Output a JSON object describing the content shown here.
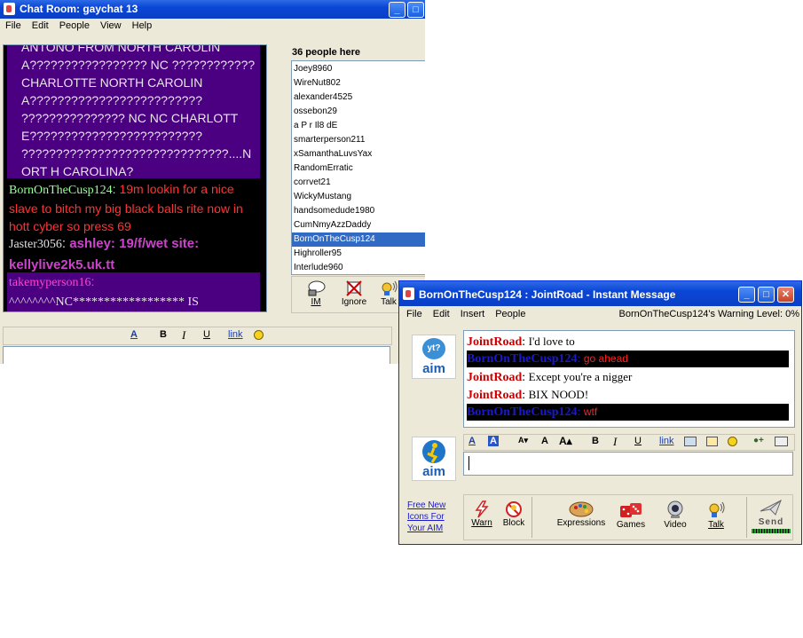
{
  "chat_window": {
    "title": "Chat Room: gaychat 13",
    "menu": [
      "File",
      "Edit",
      "People",
      "View",
      "Help"
    ],
    "messages_top_text": "ANTONO FROM NORTH CAROLINA????????????????? NC ???????????? CHARLOTTE NORTH CAROLINA????????????????????????? ??????????????? NC NC CHARLOTTE????????????????????????? ??????????????????????????????....NORT H CAROLINA?",
    "messages": [
      {
        "sender": "BornOnTheCusp124",
        "text": "19m lookin for a nice slave to bitch my big black balls rite now in hott cyber so press 69"
      },
      {
        "sender": "Jaster3056",
        "text": "ashley: 19/f/wet site: kellylive2k5.uk.tt"
      },
      {
        "sender": "takemyperson16",
        "text": "^^^^^^^^NC****************** IS"
      }
    ],
    "people_count": "36 people here",
    "people": [
      "Joey8960",
      "WireNut802",
      "alexander4525",
      "ossebon29",
      "a P r Il8 dE",
      "smarterperson211",
      "xSamanthaLuvsYax",
      "RandomErratic",
      "corrvet21",
      "WickyMustang",
      "handsomedude1980",
      "CumNmyAzzDaddy",
      "BornOnTheCusp124",
      "Highroller95",
      "Interlude960"
    ],
    "selected_person": "BornOnTheCusp124",
    "buttons": {
      "im": "IM",
      "ignore": "Ignore",
      "talk": "Talk"
    },
    "format": {
      "link": "link"
    }
  },
  "im_window": {
    "title": "BornOnTheCusp124 : JointRoad - Instant Message",
    "menu": [
      "File",
      "Edit",
      "Insert",
      "People"
    ],
    "warning": "BornOnTheCusp124's Warning Level: 0%",
    "messages": [
      {
        "sender": "JointRoad",
        "text": "I'd love to",
        "style": "remote"
      },
      {
        "sender": "BornOnTheCusp124",
        "text": "go ahead",
        "style": "local"
      },
      {
        "sender": "JointRoad",
        "text": "Except you're a nigger",
        "style": "remote"
      },
      {
        "sender": "JointRoad",
        "text": "BIX NOOD!",
        "style": "remote"
      },
      {
        "sender": "BornOnTheCusp124",
        "text": "wtf",
        "style": "local"
      }
    ],
    "buddy_icon_text": "yt?",
    "aim_label": "aim",
    "promo": "Free New Icons For Your AIM",
    "buttons": {
      "warn": "Warn",
      "block": "Block",
      "expressions": "Expressions",
      "games": "Games",
      "video": "Video",
      "talk": "Talk",
      "send": "Send"
    },
    "format": {
      "link": "link"
    }
  }
}
